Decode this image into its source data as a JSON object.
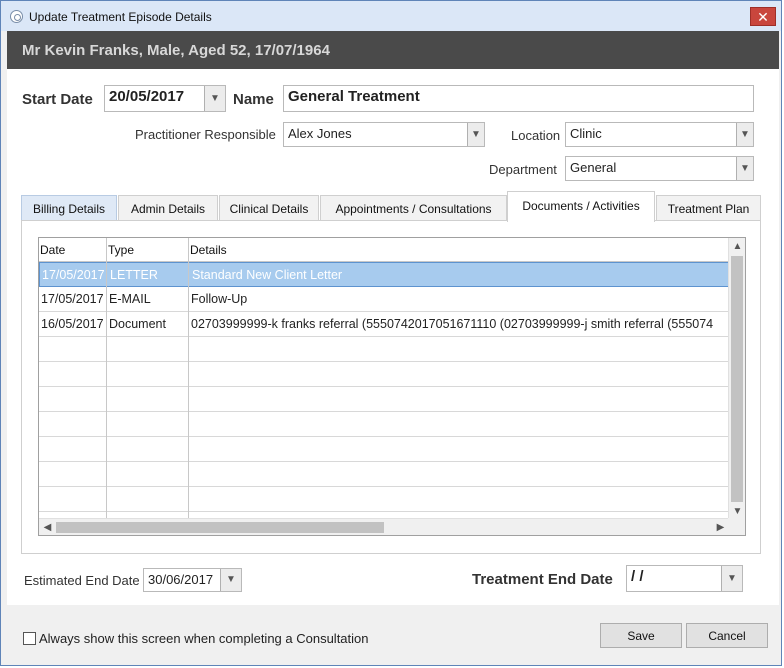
{
  "window": {
    "title": "Update Treatment Episode Details",
    "close_glyph": "✕"
  },
  "patient_banner": "Mr Kevin Franks, Male, Aged 52, 17/07/1964",
  "form": {
    "start_date_label": "Start Date",
    "start_date_value": "20/05/2017",
    "name_label": "Name",
    "name_value": "General Treatment",
    "practitioner_label": "Practitioner Responsible",
    "practitioner_value": "Alex Jones",
    "location_label": "Location",
    "location_value": "Clinic",
    "department_label": "Department",
    "department_value": "General"
  },
  "tabs": [
    {
      "label": "Billing Details"
    },
    {
      "label": "Admin Details"
    },
    {
      "label": "Clinical Details"
    },
    {
      "label": "Appointments / Consultations"
    },
    {
      "label": "Documents / Activities"
    },
    {
      "label": "Treatment Plan"
    }
  ],
  "active_tab": "Documents / Activities",
  "documents_grid": {
    "columns": [
      "Date",
      "Type",
      "Details"
    ],
    "rows": [
      {
        "date": "17/05/2017",
        "type": "LETTER",
        "details": "Standard New Client Letter"
      },
      {
        "date": "17/05/2017",
        "type": "E-MAIL",
        "details": "Follow-Up"
      },
      {
        "date": "16/05/2017",
        "type": "Document",
        "details": "02703999999-k franks referral (5550742017051671110 (02703999999-j smith referral (555074"
      }
    ],
    "selected_row": 0
  },
  "footer": {
    "estimated_end_label": "Estimated End Date",
    "estimated_end_value": "30/06/2017",
    "treatment_end_label": "Treatment End Date",
    "treatment_end_value": " /  /"
  },
  "bottom": {
    "checkbox_label": "Always show this screen when completing a Consultation",
    "checkbox_checked": false,
    "save_label": "Save",
    "cancel_label": "Cancel"
  },
  "colors": {
    "banner_bg": "#4a4a4a",
    "selection": "#a7cbee",
    "close_button": "#c9463d"
  }
}
